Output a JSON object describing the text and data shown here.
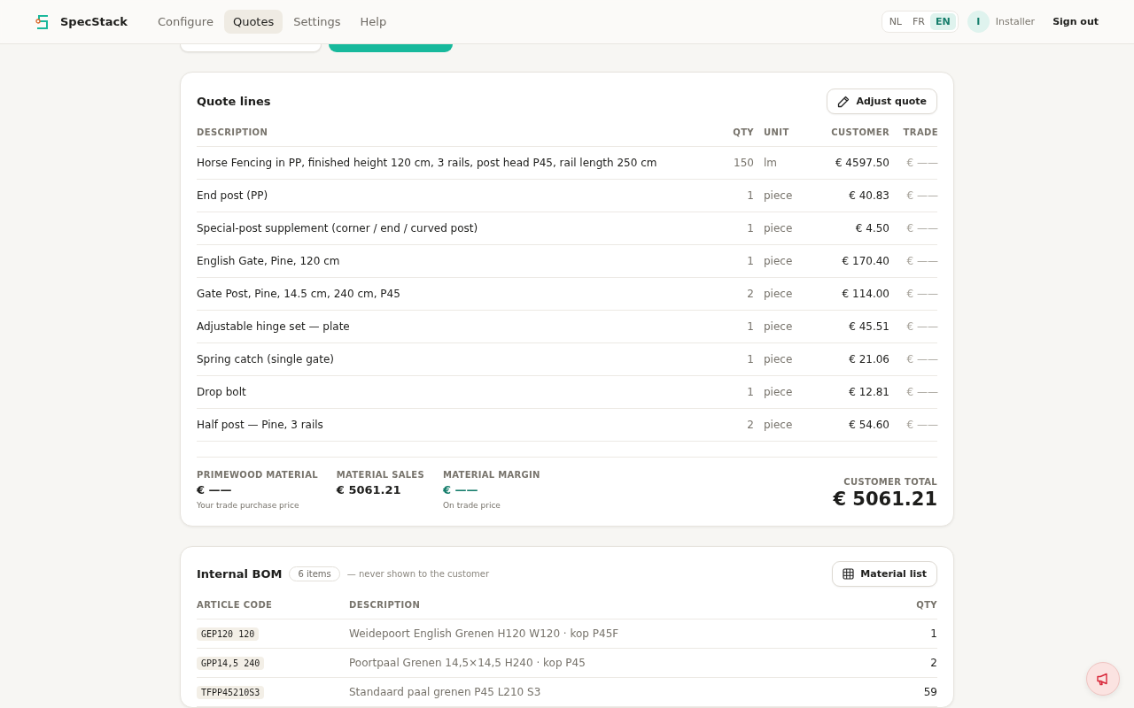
{
  "header": {
    "brand": "SpecStack",
    "nav": [
      {
        "label": "Configure",
        "selected": false
      },
      {
        "label": "Quotes",
        "selected": true
      },
      {
        "label": "Settings",
        "selected": false
      },
      {
        "label": "Help",
        "selected": false
      }
    ],
    "languages": [
      {
        "label": "NL",
        "selected": false
      },
      {
        "label": "FR",
        "selected": false
      },
      {
        "label": "EN",
        "selected": true
      }
    ],
    "avatar": "I",
    "role": "Installer",
    "sign_out": "Sign out"
  },
  "actions": [
    {
      "kind": "secondary"
    },
    {
      "kind": "primary"
    }
  ],
  "quote": {
    "title": "Quote lines",
    "adjust_button": "Adjust quote",
    "columns": [
      "DESCRIPTION",
      "QTY",
      "UNIT",
      "CUSTOMER",
      "TRADE"
    ],
    "rows": [
      {
        "description": "Horse Fencing in PP, finished height 120 cm, 3 rails, post head P45, rail length 250 cm",
        "qty": "150",
        "unit": "lm",
        "customer": "€ 4597.50",
        "trade": "€ ——"
      },
      {
        "description": "End post (PP)",
        "qty": "1",
        "unit": "piece",
        "customer": "€ 40.83",
        "trade": "€ ——"
      },
      {
        "description": "Special-post supplement (corner / end / curved post)",
        "qty": "1",
        "unit": "piece",
        "customer": "€ 4.50",
        "trade": "€ ——"
      },
      {
        "description": "English Gate, Pine, 120 cm",
        "qty": "1",
        "unit": "piece",
        "customer": "€ 170.40",
        "trade": "€ ——"
      },
      {
        "description": "Gate Post, Pine, 14.5 cm, 240 cm, P45",
        "qty": "2",
        "unit": "piece",
        "customer": "€ 114.00",
        "trade": "€ ——"
      },
      {
        "description": "Adjustable hinge set — plate",
        "qty": "1",
        "unit": "piece",
        "customer": "€ 45.51",
        "trade": "€ ——"
      },
      {
        "description": "Spring catch (single gate)",
        "qty": "1",
        "unit": "piece",
        "customer": "€ 21.06",
        "trade": "€ ——"
      },
      {
        "description": "Drop bolt",
        "qty": "1",
        "unit": "piece",
        "customer": "€ 12.81",
        "trade": "€ ——"
      },
      {
        "description": "Half post — Pine, 3 rails",
        "qty": "2",
        "unit": "piece",
        "customer": "€ 54.60",
        "trade": "€ ——"
      }
    ],
    "summary": [
      {
        "label": "PRIMEWOOD MATERIAL",
        "value": "€ ——",
        "note": "Your trade purchase price",
        "kind": "plain"
      },
      {
        "label": "MATERIAL SALES",
        "value": "€ 5061.21",
        "kind": "plain"
      },
      {
        "label": "MATERIAL MARGIN",
        "value": "€ ——",
        "note": "On trade price",
        "kind": "accent"
      }
    ],
    "total_label": "CUSTOMER TOTAL",
    "total": "€ 5061.21"
  },
  "bom": {
    "title": "Internal BOM",
    "count": "6 items",
    "note": "— never shown to the customer",
    "button": "Material list",
    "columns": [
      "ARTICLE CODE",
      "DESCRIPTION",
      "QTY"
    ],
    "rows": [
      {
        "code": "GEP120 120",
        "description": "Weidepoort English Grenen H120 W120 · kop P45F",
        "qty": "1"
      },
      {
        "code": "GPP14,5 240",
        "description": "Poortpaal Grenen 14,5×14,5 H240 · kop P45",
        "qty": "2"
      },
      {
        "code": "TFPP45210S3",
        "description": "Standaard paal grenen P45 L210 S3",
        "qty": "59"
      }
    ]
  }
}
